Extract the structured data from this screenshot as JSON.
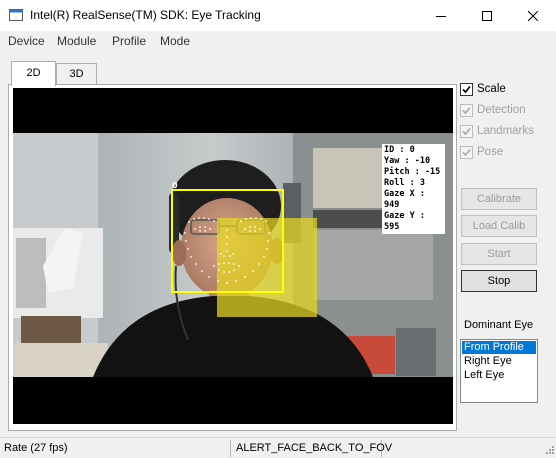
{
  "window": {
    "title": "Intel(R) RealSense(TM) SDK: Eye Tracking",
    "icon": "app-icon",
    "controls": [
      "minimize-icon",
      "maximize-icon",
      "close-icon"
    ]
  },
  "menu": {
    "items": [
      "Device",
      "Module",
      "Profile",
      "Mode"
    ]
  },
  "tabs": [
    {
      "label": "2D",
      "active": true
    },
    {
      "label": "3D",
      "active": false
    }
  ],
  "video": {
    "face_id": "0",
    "hud": {
      "line1": "ID : 0",
      "line2": "Yaw : -10",
      "line3": "Pitch : -15",
      "line4": "Roll : 3",
      "line5": "Gaze X : 949",
      "line6": "Gaze Y : 595"
    },
    "colors": {
      "face_box": "#ffff00",
      "gaze_box": "#e6d820",
      "landmarks": "#ffffff"
    }
  },
  "options": {
    "scale": {
      "label": "Scale",
      "checked": true,
      "enabled": true
    },
    "detection": {
      "label": "Detection",
      "checked": true,
      "enabled": false
    },
    "landmarks": {
      "label": "Landmarks",
      "checked": true,
      "enabled": false
    },
    "pose": {
      "label": "Pose",
      "checked": true,
      "enabled": false
    }
  },
  "buttons": {
    "calibrate": "Calibrate",
    "load_calib": "Load Calib",
    "start": "Start",
    "stop": "Stop"
  },
  "dominant_eye": {
    "label": "Dominant Eye",
    "options": [
      "From Profile",
      "Right Eye",
      "Left Eye"
    ],
    "selected": "From Profile"
  },
  "status": {
    "rate": "Rate (27 fps)",
    "alert": "ALERT_FACE_BACK_TO_FOV"
  }
}
